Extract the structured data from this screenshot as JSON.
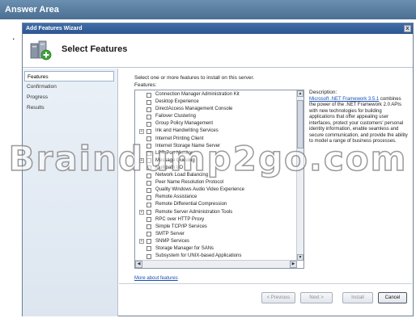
{
  "answer_area": {
    "title": "Answer Area"
  },
  "bullet": ".",
  "window": {
    "title": "Add Features Wizard",
    "close_glyph": "x",
    "page_title": "Select Features"
  },
  "nav": {
    "items": [
      {
        "label": "Features",
        "active": true
      },
      {
        "label": "Confirmation",
        "active": false
      },
      {
        "label": "Progress",
        "active": false
      },
      {
        "label": "Results",
        "active": false
      }
    ]
  },
  "content": {
    "instruction": "Select one or more features to install on this server.",
    "features_label": "Features:",
    "features": [
      {
        "label": "Connection Manager Administration Kit",
        "expandable": false
      },
      {
        "label": "Desktop Experience",
        "expandable": false
      },
      {
        "label": "DirectAccess Management Console",
        "expandable": false
      },
      {
        "label": "Failover Clustering",
        "expandable": false
      },
      {
        "label": "Group Policy Management",
        "expandable": false
      },
      {
        "label": "Ink and Handwriting Services",
        "expandable": true
      },
      {
        "label": "Internet Printing Client",
        "expandable": false
      },
      {
        "label": "Internet Storage Name Server",
        "expandable": false
      },
      {
        "label": "LPR Port Monitor",
        "expandable": false
      },
      {
        "label": "Message Queuing",
        "expandable": true
      },
      {
        "label": "Multipath I/O",
        "expandable": false
      },
      {
        "label": "Network Load Balancing",
        "expandable": false
      },
      {
        "label": "Peer Name Resolution Protocol",
        "expandable": false
      },
      {
        "label": "Quality Windows Audio Video Experience",
        "expandable": false
      },
      {
        "label": "Remote Assistance",
        "expandable": false
      },
      {
        "label": "Remote Differential Compression",
        "expandable": false
      },
      {
        "label": "Remote Server Administration Tools",
        "expandable": true
      },
      {
        "label": "RPC over HTTP Proxy",
        "expandable": false
      },
      {
        "label": "Simple TCP/IP Services",
        "expandable": false
      },
      {
        "label": "SMTP Server",
        "expandable": false
      },
      {
        "label": "SNMP Services",
        "expandable": true
      },
      {
        "label": "Storage Manager for SANs",
        "expandable": false
      },
      {
        "label": "Subsystem for UNIX-based Applications",
        "expandable": false
      }
    ],
    "description": {
      "title": "Description:",
      "link": "Microsoft .NET Framework 3.5.1",
      "body": "combines the power of the .NET Framework 2.0 APIs with new technologies for building applications that offer appealing user interfaces, protect your customers' personal identity information, enable seamless and secure communication, and provide the ability to model a range of business processes."
    },
    "more_link": "More about features"
  },
  "buttons": {
    "previous": "< Previous",
    "next": "Next >",
    "install": "Install",
    "cancel": "Cancel"
  },
  "watermark": "Braindump2go.com"
}
